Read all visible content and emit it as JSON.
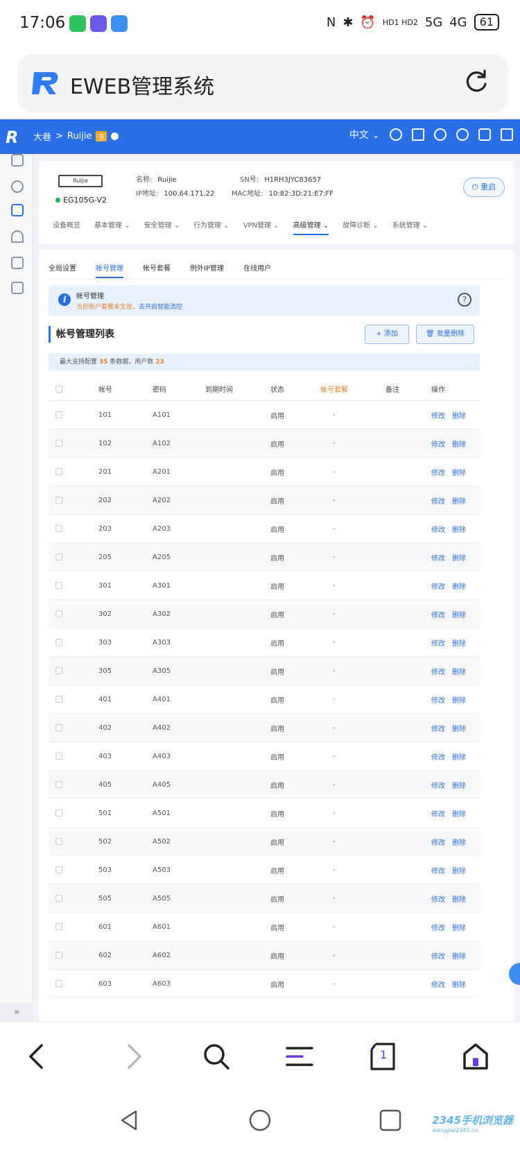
{
  "status_bar": {
    "time": "17:06",
    "indicators": [
      "N",
      "✱",
      "⏰",
      "HD1 HD2",
      "5G",
      "4G"
    ],
    "battery": "61"
  },
  "browser": {
    "title": "EWEB管理系统"
  },
  "app_header": {
    "logo": "R",
    "breadcrumb_home": "大巷",
    "breadcrumb_sep": ">",
    "breadcrumb_device": "Ruijie",
    "breadcrumb_tag": "主",
    "language": "中文 ⌄"
  },
  "device": {
    "image_label": "Ruijie",
    "model": "EG105G-V2",
    "name_label": "名称:",
    "name_value": "Ruijie",
    "ip_label": "IP地址:",
    "ip_value": "100.64.171.22",
    "sn_label": "SN号:",
    "sn_value": "H1RH3JYC83657",
    "mac_label": "MAC地址:",
    "mac_value": "10:82:3D:21:E7:FF",
    "reboot_label": "重启"
  },
  "top_nav": [
    "设备概览",
    "基本管理 ⌄",
    "安全管理 ⌄",
    "行为管理 ⌄",
    "VPN管理 ⌄",
    "高级管理 ⌄",
    "故障诊断 ⌄",
    "系统管理 ⌄"
  ],
  "sub_tabs": [
    "全局设置",
    "帐号管理",
    "帐号套餐",
    "例外IP管理",
    "在线用户"
  ],
  "banner": {
    "title": "帐号管理",
    "text_prefix": "当前账户套餐未生效，",
    "text_link": "去开启智能流控"
  },
  "list": {
    "title": "帐号管理列表",
    "add_label": "+ 添加",
    "batch_delete_label": "批量删除",
    "limit_prefix": "最大支持配置",
    "limit_max": "35",
    "limit_mid": "条数据，用户数",
    "limit_users": "23"
  },
  "table": {
    "headers": {
      "account": "帐号",
      "password": "密码",
      "expire": "到期时间",
      "status": "状态",
      "package": "帐号套餐",
      "note": "备注",
      "ops": "操作"
    },
    "edit_label": "修改",
    "delete_label": "删除",
    "rows": [
      {
        "account": "101",
        "password": "A101",
        "status": "启用",
        "package": "-"
      },
      {
        "account": "102",
        "password": "A102",
        "status": "启用",
        "package": "-"
      },
      {
        "account": "201",
        "password": "A201",
        "status": "启用",
        "package": "-"
      },
      {
        "account": "202",
        "password": "A202",
        "status": "启用",
        "package": "-"
      },
      {
        "account": "203",
        "password": "A203",
        "status": "启用",
        "package": "-"
      },
      {
        "account": "205",
        "password": "A205",
        "status": "启用",
        "package": "-"
      },
      {
        "account": "301",
        "password": "A301",
        "status": "启用",
        "package": "-"
      },
      {
        "account": "302",
        "password": "A302",
        "status": "启用",
        "package": "-"
      },
      {
        "account": "303",
        "password": "A303",
        "status": "启用",
        "package": "-"
      },
      {
        "account": "305",
        "password": "A305",
        "status": "启用",
        "package": "-"
      },
      {
        "account": "401",
        "password": "A401",
        "status": "启用",
        "package": "-"
      },
      {
        "account": "402",
        "password": "A402",
        "status": "启用",
        "package": "-"
      },
      {
        "account": "403",
        "password": "A403",
        "status": "启用",
        "package": "-"
      },
      {
        "account": "405",
        "password": "A405",
        "status": "启用",
        "package": "-"
      },
      {
        "account": "501",
        "password": "A501",
        "status": "启用",
        "package": "-"
      },
      {
        "account": "502",
        "password": "A502",
        "status": "启用",
        "package": "-"
      },
      {
        "account": "503",
        "password": "A503",
        "status": "启用",
        "package": "-"
      },
      {
        "account": "505",
        "password": "A505",
        "status": "启用",
        "package": "-"
      },
      {
        "account": "601",
        "password": "A601",
        "status": "启用",
        "package": "-"
      },
      {
        "account": "602",
        "password": "A602",
        "status": "启用",
        "package": "-"
      },
      {
        "account": "603",
        "password": "A603",
        "status": "启用",
        "package": "-"
      }
    ]
  },
  "rail": {
    "expand_label": "»"
  },
  "toolbar": {
    "tabs_count": "1"
  },
  "watermark": {
    "title": "2345手机浏览器",
    "url": "wangpai2345.cn"
  },
  "colors": {
    "accent": "#2b6fe8",
    "warning": "#e8822b",
    "online": "#1fb35b"
  }
}
